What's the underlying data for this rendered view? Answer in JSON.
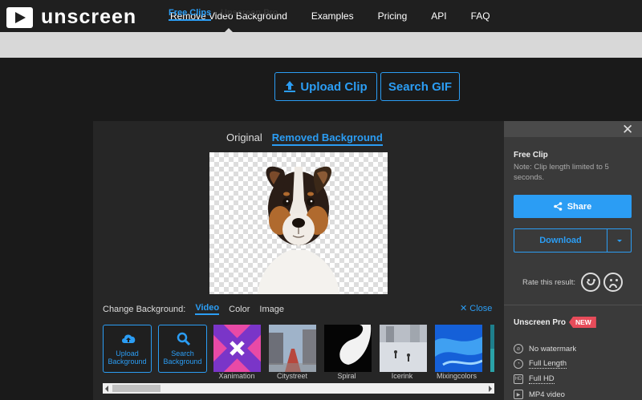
{
  "header": {
    "logo_text": "unscreen",
    "nav": [
      "Remove Video Background",
      "Examples",
      "Pricing",
      "API",
      "FAQ"
    ]
  },
  "subnav": {
    "free": "Free Clips",
    "pro": "Unscreen Pro"
  },
  "actions": {
    "upload": "Upload Clip",
    "search_gif": "Search GIF"
  },
  "editor": {
    "tab_original": "Original",
    "tab_removed": "Removed Background",
    "change_bg_label": "Change Background:",
    "bg_tabs": [
      "Video",
      "Color",
      "Image"
    ],
    "close_label": "Close",
    "upload_bg": "Upload Background",
    "search_bg": "Search Background",
    "thumbs": [
      "Xanimation",
      "Citystreet",
      "Spiral",
      "Icerink",
      "Mixingcolors"
    ]
  },
  "panel": {
    "free_clip_title": "Free Clip",
    "free_clip_note": "Note: Clip length limited to 5 seconds.",
    "share": "Share",
    "download": "Download",
    "rate_label": "Rate this result:",
    "pro_title": "Unscreen Pro",
    "new_badge": "NEW",
    "features": [
      "No watermark",
      "Full Length",
      "Full HD",
      "MP4 video"
    ]
  },
  "colors": {
    "accent": "#2b9df4",
    "badge": "#e74c5a"
  }
}
